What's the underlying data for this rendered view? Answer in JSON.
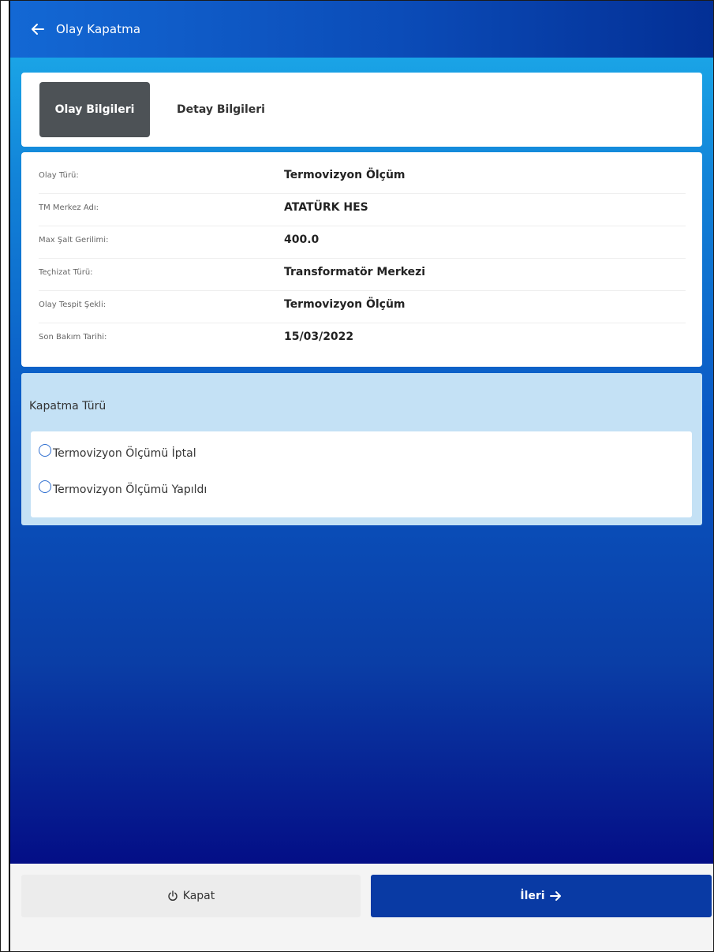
{
  "header": {
    "title": "Olay Kapatma",
    "back_icon": "arrow-left-icon"
  },
  "tabs": [
    {
      "label": "Olay Bilgileri",
      "active": true
    },
    {
      "label": "Detay Bilgileri",
      "active": false
    }
  ],
  "info": [
    {
      "label": "Olay Türü:",
      "value": "Termovizyon Ölçüm"
    },
    {
      "label": "TM Merkez Adı:",
      "value": "ATATÜRK HES"
    },
    {
      "label": "Max Şalt Gerilimi:",
      "value": "400.0"
    },
    {
      "label": "Teçhizat Türü:",
      "value": "Transformatör Merkezi"
    },
    {
      "label": "Olay Tespit Şekli:",
      "value": "Termovizyon Ölçüm"
    },
    {
      "label": "Son Bakım Tarihi:",
      "value": "15/03/2022"
    }
  ],
  "closure": {
    "title": "Kapatma Türü",
    "options": [
      {
        "label": "Termovizyon Ölçümü İptal",
        "selected": false
      },
      {
        "label": "Termovizyon Ölçümü Yapıldı",
        "selected": false
      }
    ]
  },
  "footer": {
    "close_label": "Kapat",
    "close_icon": "power-icon",
    "next_label": "İleri",
    "next_icon": "arrow-right-icon"
  },
  "colors": {
    "header": "#0b4cb8",
    "active_tab": "#4d5256",
    "next_button": "#093aa4",
    "closure_panel": "#c4e1f5"
  }
}
